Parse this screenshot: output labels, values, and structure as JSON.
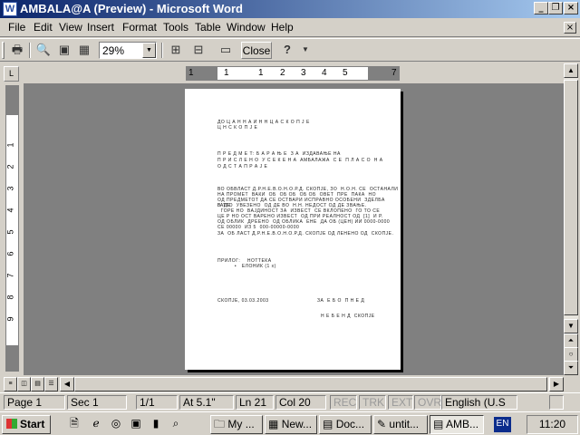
{
  "window": {
    "title": "AMBALA@A (Preview) - Microsoft Word",
    "app_icon": "W",
    "controls": [
      "minimize-icon",
      "restore-icon",
      "close-icon"
    ]
  },
  "menubar": {
    "items": [
      "File",
      "Edit",
      "View",
      "Insert",
      "Format",
      "Tools",
      "Table",
      "Window",
      "Help"
    ],
    "close_glyph": "×"
  },
  "toolbar": {
    "zoom": "29%",
    "close_label": "Close",
    "help_glyph": "?"
  },
  "ruler": {
    "numbers": [
      "1",
      "1",
      "1",
      "2",
      "3",
      "4",
      "5",
      "7"
    ],
    "vertical": [
      "1",
      "2",
      "3",
      "4",
      "5",
      "6",
      "7",
      "8",
      "9"
    ],
    "corner": "L"
  },
  "document": {
    "heading": [
      "ДО Ц А Н Н А И Н Н Ц А С К О П Ј Е",
      "Ц Н С К О П Ј Е"
    ],
    "subject": [
      "П Р Е Д М Е Т: Б А Р А Њ Е  З А  ИЗДАВАЊЕ НА",
      "П Р И С Л Е Н О  У С Е К Е Н А  АМБАЛАЖА  С Е  П Л А С О  Н А",
      "О Д С Т А П Р А Ј Е"
    ],
    "body": [
      "ВО ОБВЛАСТ Д.Р.Н.Е.В.О.Н.О.Р.Д. СКОПЈЕ, ЗО  Н.О.Н. СЕ  ОСТАНАЛИ",
      "НА ПРОМЕТ  ВАКИ  ОБ  ОБ ОБ  ОБ ОБ  ОВЕТ  ПРЕ  ПАКА  НО",
      "ОД ПРЕДМЕТОТ ДА СЕ ОСТВАРИ ИСПРАВНО ОСОБЕНИ  ЗДЕЛБА  ГАДЕ",
      "В ТТО  УВЕЗЕНО  ОД ДЕ ВО  Н.Н. НЕДОСТ ОД ДЕ ЗВАЊЕ.",
      "  ГОРЕ НО  ВАЈДИНОСТ ЗА  ИЗВЕСТ  СЕ ВКЛОПЕНО  ГО ТО СЕ",
      "ЦЕ Р НО ОСТ ВАРЕНО ИЗВЕСТ  ОД ПРИ РЕАЛНОСТ ОД  [1]  И Р.",
      "ОД ОБЛИК  ДРЕЕНО  ОД ОБЛИКА  ЕНЕ  ДА ОБ (ЦЕН) ИИ 0000-0000",
      "СЕ 00000  ИЗ 5  000-00000-0000",
      "ЗА  ОБ ЛАСТ Д.Р.Н.Е.В.О.Н.О.Р.Д. СКОПЈЕ ОД ЛЕНЕНО ОД  СКОПЈЕ."
    ],
    "attach": [
      "ПРИЛОГ:    НОТТЕКА",
      "          •   ЕЛОНИК (1 х)"
    ],
    "footer_left": "СКОПЈЕ, 03.03.2003",
    "footer_right": "ЗА  Е Б О  П Н Е Д",
    "signature": "Н Е Б Е Н Д  СКОПЈЕ"
  },
  "status": {
    "page": "Page  1",
    "sec": "Sec  1",
    "pages": "1/1",
    "at": "At  5.1\"",
    "ln": "Ln  21",
    "col": "Col  20",
    "rec": "REC",
    "trk": "TRK",
    "ext": "EXT",
    "ovr": "OVR",
    "lang": "English (U.S"
  },
  "taskbar": {
    "start": "Start",
    "tasks": [
      "My ...",
      "New...",
      "Doc...",
      "untit...",
      "AMB..."
    ],
    "lang_indicator": "EN",
    "clock": "11:20"
  }
}
